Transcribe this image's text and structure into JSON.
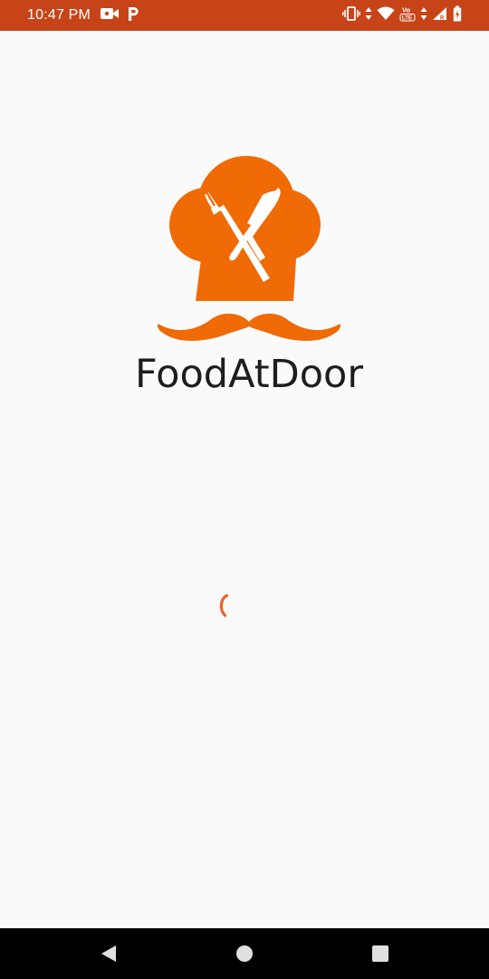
{
  "status_bar": {
    "time": "10:47 PM",
    "background_color": "#c74418",
    "left_icons": [
      "video-camera-icon",
      "p-notification-icon"
    ],
    "right_icons": [
      "vibrate-icon",
      "data-arrows-icon",
      "wifi-icon",
      "volte-icon",
      "signal-icon",
      "battery-icon"
    ],
    "volte_label": "Vo\nLTE"
  },
  "app": {
    "name": "FoodAtDoor",
    "logo_icon": "chef-hat-fork-knife-mustache-logo",
    "logo_color": "#f06a06",
    "background_color": "#fafafa",
    "loading_indicator": "spinner-icon",
    "spinner_color": "#e8642a"
  },
  "nav_bar": {
    "buttons": [
      "back-icon",
      "home-icon",
      "recents-icon"
    ]
  }
}
